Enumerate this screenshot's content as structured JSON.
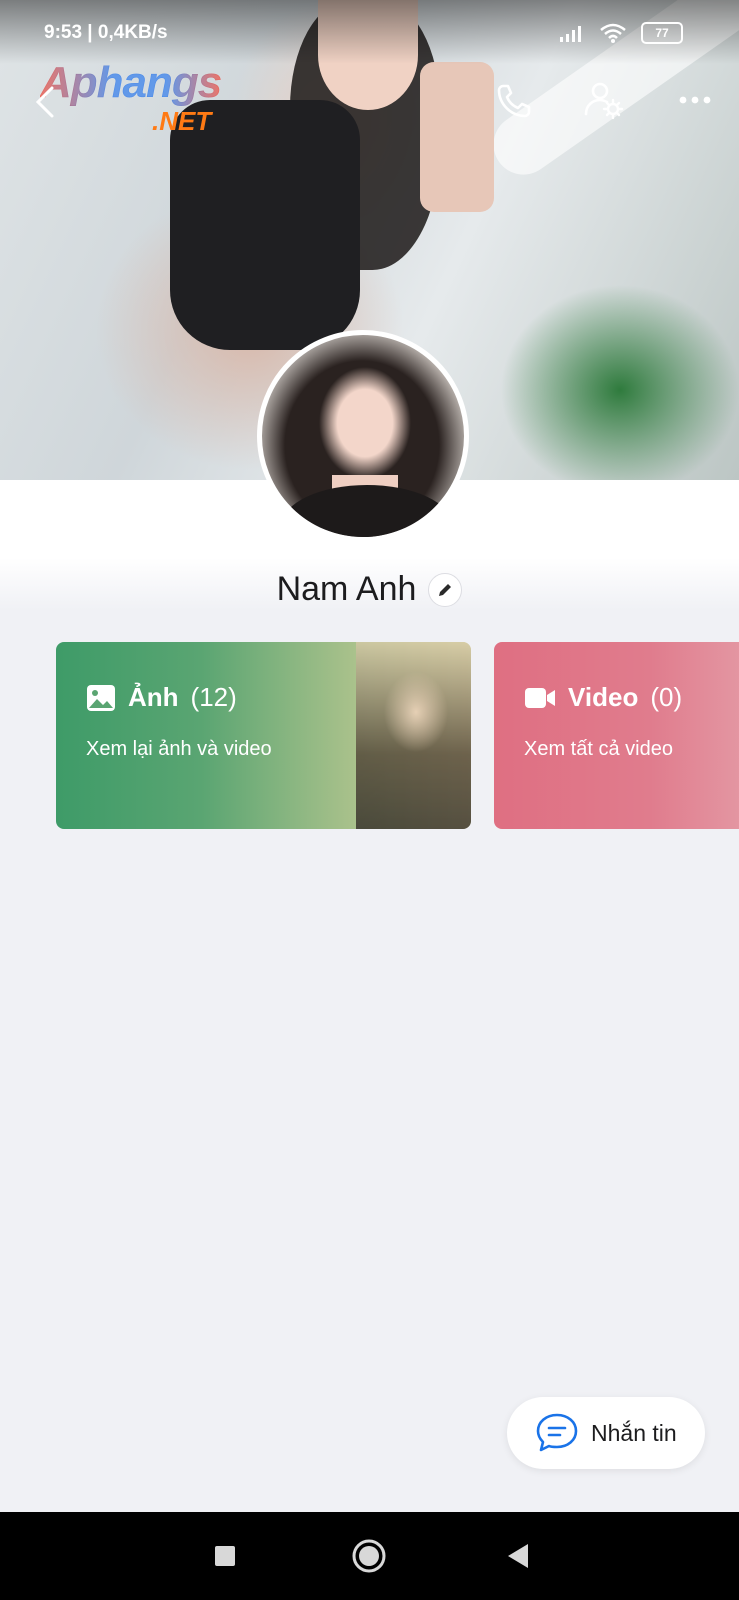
{
  "status_bar": {
    "time": "9:53 | 0,4KB/s",
    "battery": "77"
  },
  "watermark": {
    "line1": "Aphangs",
    "line2": ".NET"
  },
  "profile": {
    "name": "Nam Anh"
  },
  "cards": {
    "photos": {
      "title": "Ảnh",
      "count": "(12)",
      "subtitle": "Xem lại ảnh và video"
    },
    "videos": {
      "title": "Video",
      "count": "(0)",
      "subtitle": "Xem tất cả video"
    }
  },
  "message_button": {
    "label": "Nhắn tin"
  },
  "colors": {
    "photos_card": "#3e9b68",
    "videos_card": "#df6f82",
    "accent": "#1a73e8"
  }
}
